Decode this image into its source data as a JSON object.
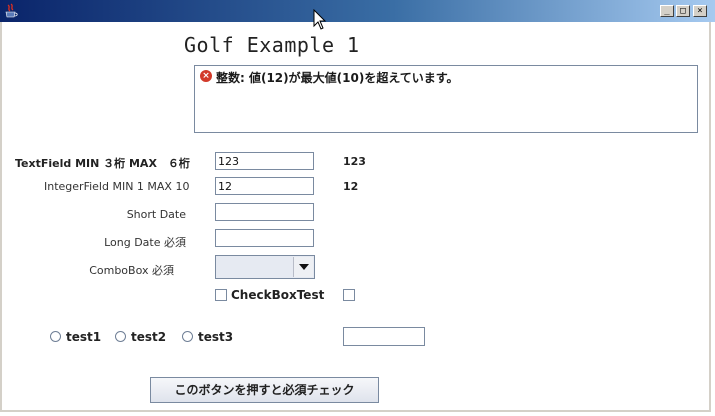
{
  "window": {
    "title": "",
    "minimize_glyph": "_",
    "maximize_glyph": "□",
    "close_glyph": "×"
  },
  "header": {
    "title": "Golf Example 1"
  },
  "message": {
    "error_glyph": "×",
    "text": "整数: 値(12)が最大値(10)を超えています。"
  },
  "form": {
    "textfield": {
      "label": "TextField MIN ３桁 MAX　６桁",
      "value": "123",
      "echo": "123"
    },
    "integerfield": {
      "label": "IntegerField MIN 1 MAX  10",
      "value": "12",
      "echo": "12"
    },
    "short_date": {
      "label": "Short Date",
      "value": ""
    },
    "long_date": {
      "label": "Long Date 必須",
      "value": ""
    },
    "combobox": {
      "label": "ComboBox 必須",
      "value": ""
    },
    "checkbox": {
      "label": "CheckBoxTest"
    },
    "radios": [
      {
        "label": "test1"
      },
      {
        "label": "test2"
      },
      {
        "label": "test3"
      }
    ],
    "extra_field": {
      "value": ""
    }
  },
  "actions": {
    "check_button": "このボタンを押すと必須チェック"
  },
  "colors": {
    "titlebar_start": "#0a246a",
    "titlebar_end": "#a6caf0",
    "error": "#d23a2a"
  }
}
